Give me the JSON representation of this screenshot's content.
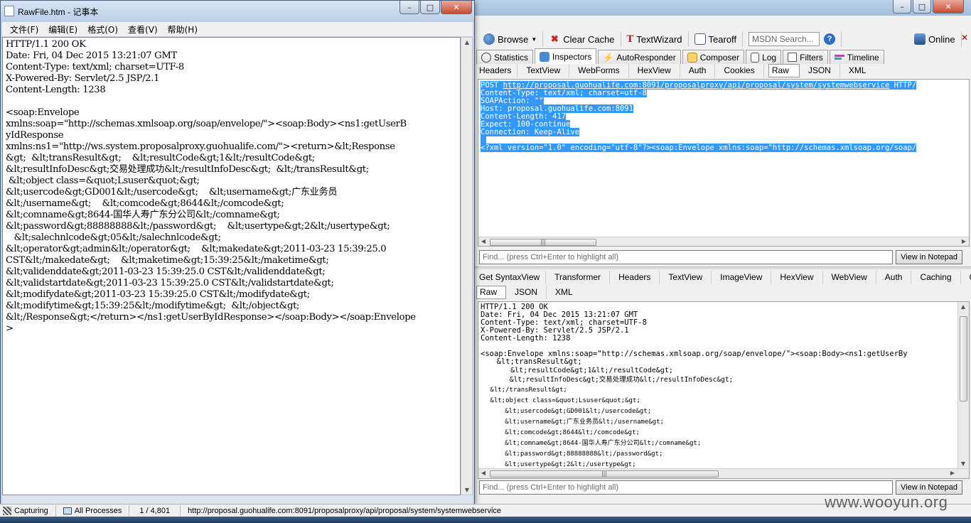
{
  "notepad": {
    "title": "RawFile.htm - 记事本",
    "menu": [
      "文件(F)",
      "编辑(E)",
      "格式(O)",
      "查看(V)",
      "帮助(H)"
    ],
    "lines": [
      "HTTP/1.1 200 OK",
      "Date: Fri, 04 Dec 2015 13:21:07 GMT",
      "Content-Type: text/xml; charset=UTF-8",
      "X-Powered-By: Servlet/2.5 JSP/2.1",
      "Content-Length: 1238",
      "",
      "<soap:Envelope",
      "xmlns:soap=\"http://schemas.xmlsoap.org/soap/envelope/\"><soap:Body><ns1:getUserB",
      "yIdResponse",
      "xmlns:ns1=\"http://ws.system.proposalproxy.guohualife.com/\"><return>&lt;Response",
      "&gt;  &lt;transResult&gt;    &lt;resultCode&gt;1&lt;/resultCode&gt;",
      "&lt;resultInfoDesc&gt;交易处理成功&lt;/resultInfoDesc&gt;  &lt;/transResult&gt;",
      " &lt;object class=&quot;Lsuser&quot;&gt;",
      "&lt;usercode&gt;GD001&lt;/usercode&gt;    &lt;username&gt;广东业务员",
      "&lt;/username&gt;    &lt;comcode&gt;8644&lt;/comcode&gt;",
      "&lt;comname&gt;8644-国华人寿广东分公司&lt;/comname&gt;",
      "&lt;password&gt;88888888&lt;/password&gt;    &lt;usertype&gt;2&lt;/usertype&gt;",
      "   &lt;salechnlcode&gt;05&lt;/salechnlcode&gt;",
      "&lt;operator&gt;admin&lt;/operator&gt;    &lt;makedate&gt;2011-03-23 15:39:25.0",
      "CST&lt;/makedate&gt;    &lt;maketime&gt;15:39:25&lt;/maketime&gt;",
      "&lt;validenddate&gt;2011-03-23 15:39:25.0 CST&lt;/validenddate&gt;",
      "&lt;validstartdate&gt;2011-03-23 15:39:25.0 CST&lt;/validstartdate&gt;",
      "&lt;modifydate&gt;2011-03-23 15:39:25.0 CST&lt;/modifydate&gt;",
      "&lt;modifytime&gt;15:39:25&lt;/modifytime&gt;  &lt;/object&gt;",
      "&lt;/Response&gt;</return></ns1:getUserByIdResponse></soap:Body></soap:Envelope",
      ">"
    ]
  },
  "fiddler": {
    "toolbar": {
      "browse": "Browse",
      "clear_cache": "Clear Cache",
      "textwizard": "TextWizard",
      "tearoff": "Tearoff",
      "search_placeholder": "MSDN Search...",
      "online": "Online"
    },
    "main_tabs": [
      "Statistics",
      "Inspectors",
      "AutoResponder",
      "Composer",
      "Log",
      "Filters",
      "Timeline"
    ],
    "request_tabs": [
      "Headers",
      "TextView",
      "WebForms",
      "HexView",
      "Auth",
      "Cookies",
      "Raw",
      "JSON",
      "XML"
    ],
    "request_raw": {
      "method": "POST ",
      "url": "http://proposal.guohualife.com:8091/proposalproxy/api/proposal/system/systemwebservice",
      "protocol": " HTTP/",
      "lines": [
        "Content-Type: text/xml; charset=utf-8",
        "SOAPAction: \"\"",
        "Host: proposal.guohualife.com:8091",
        "Content-Length: 417",
        "Expect: 100-continue",
        "Connection: Keep-Alive",
        "",
        "<?xml version=\"1.0\" encoding=\"utf-8\"?><soap:Envelope xmlns:soap=\"http://schemas.xmlsoap.org/soap/"
      ]
    },
    "find_placeholder": "Find... (press Ctrl+Enter to highlight all)",
    "view_in_notepad": "View in Notepad",
    "response_tabs_row1": [
      "Get SyntaxView",
      "Transformer",
      "Headers",
      "TextView",
      "ImageView",
      "HexView",
      "WebView",
      "Auth",
      "Caching",
      "Cookies"
    ],
    "response_tabs_row2": [
      "Raw",
      "JSON",
      "XML"
    ],
    "response_raw": [
      "HTTP/1.1 200 OK",
      "Date: Fri, 04 Dec 2015 13:21:07 GMT",
      "Content-Type: text/xml; charset=UTF-8",
      "X-Powered-By: Servlet/2.5 JSP/2.1",
      "Content-Length: 1238",
      "",
      "<soap:Envelope xmlns:soap=\"http://schemas.xmlsoap.org/soap/envelope/\"><soap:Body><ns1:getUserBy",
      "  &lt;transResult&gt;",
      "    &lt;resultCode&gt;1&lt;/resultCode&gt;",
      "    &lt;resultInfoDesc&gt;交易处理成功&lt;/resultInfoDesc&gt;",
      " &lt;/transResult&gt;",
      " &lt;object class=&quot;Lsuser&quot;&gt;",
      "   &lt;usercode&gt;GD001&lt;/usercode&gt;",
      "   &lt;username&gt;广东业务员&lt;/username&gt;",
      "   &lt;comcode&gt;8644&lt;/comcode&gt;",
      "   &lt;comname&gt;8644-国华人寿广东分公司&lt;/comname&gt;",
      "   &lt;password&gt;88888888&lt;/password&gt;",
      "   &lt;usertype&gt;2&lt;/usertype&gt;"
    ]
  },
  "statusbar": {
    "capturing": "Capturing",
    "processes": "All Processes",
    "count": "1 / 4,801",
    "url": "http://proposal.guohualife.com:8091/proposalproxy/api/proposal/system/systemwebservice"
  },
  "watermark": "www.wooyun.org"
}
